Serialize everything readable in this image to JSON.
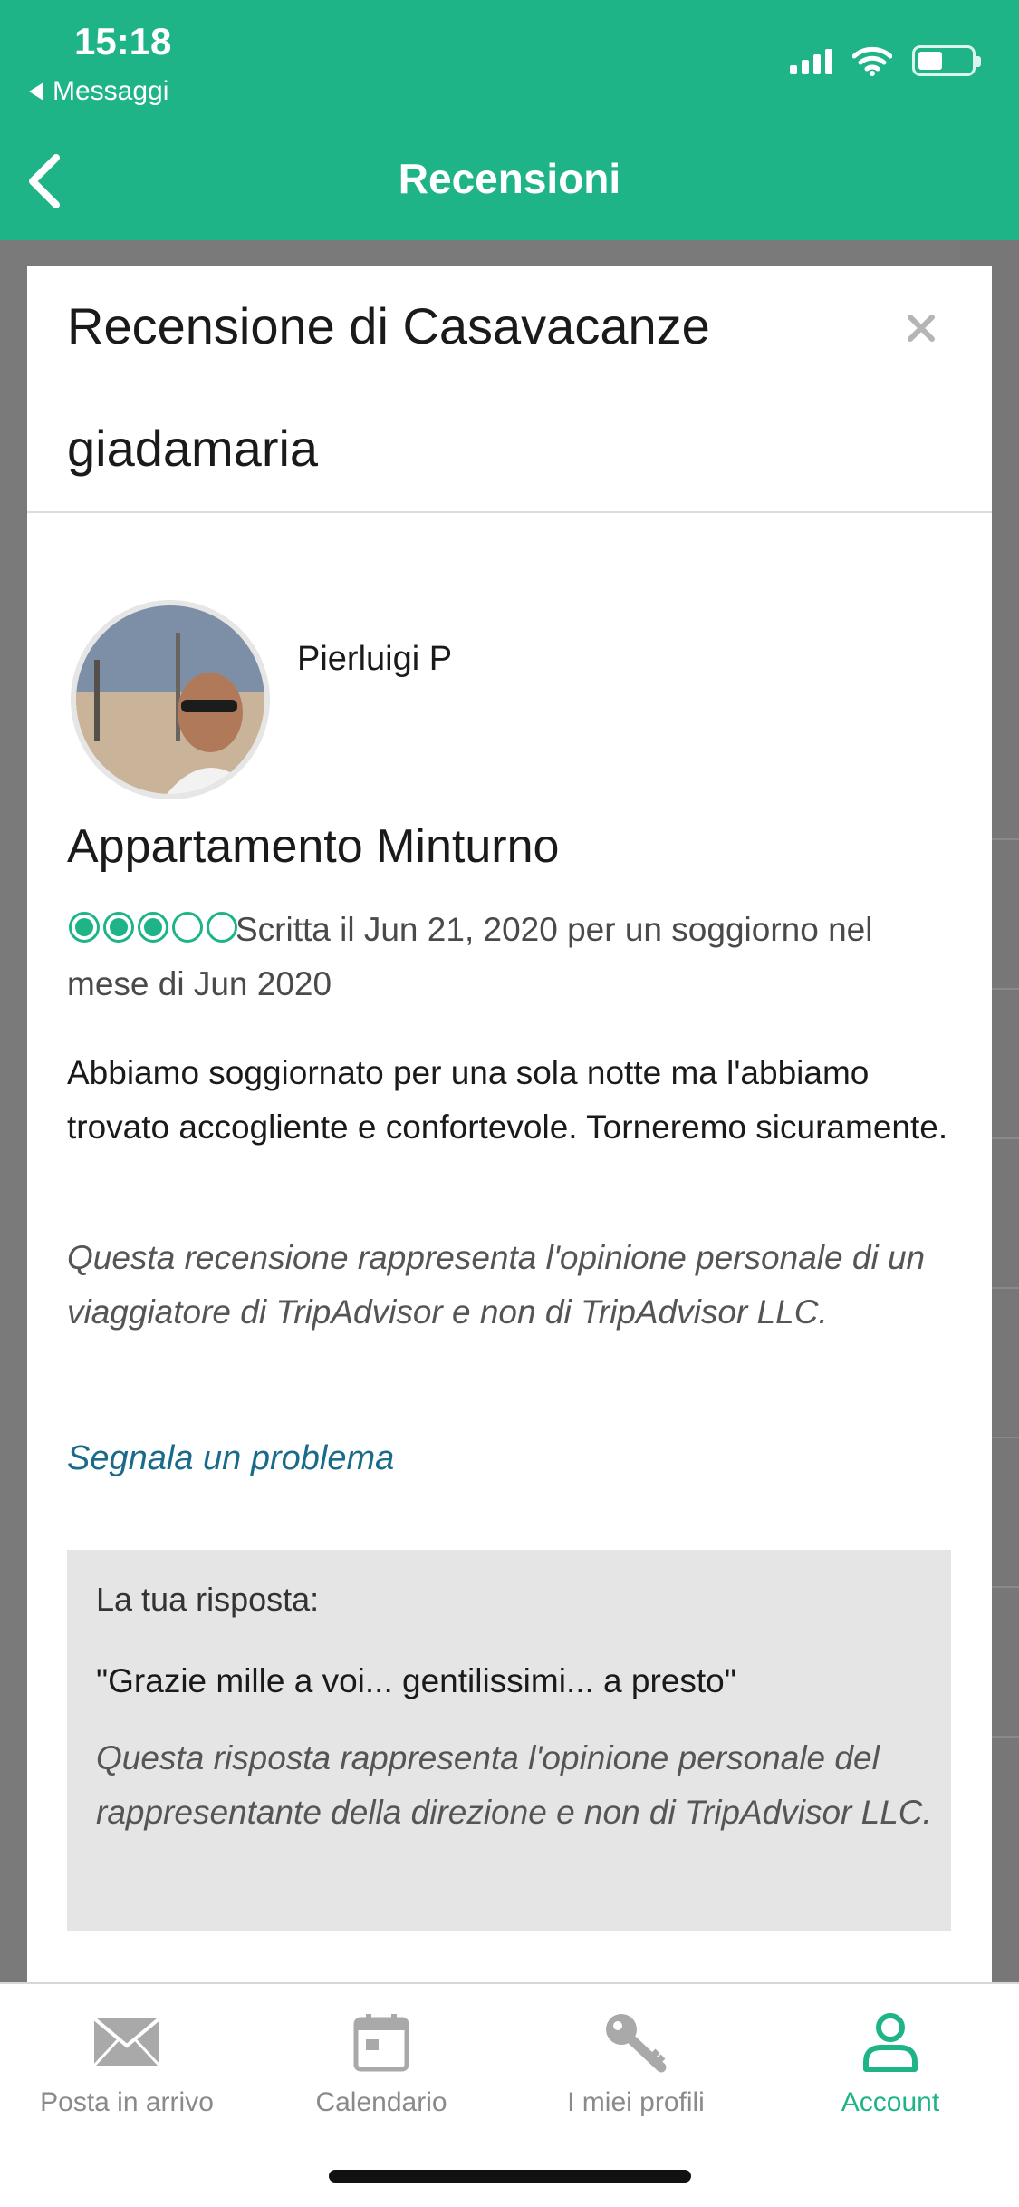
{
  "status_bar": {
    "time": "15:18",
    "back_app": "Messaggi"
  },
  "nav": {
    "title": "Recensioni"
  },
  "modal": {
    "title": "Recensione di Casavacanze giadamaria"
  },
  "review": {
    "author": "Pierluigi P",
    "title": "Appartamento Minturno",
    "rating": 3,
    "rating_max": 5,
    "meta": "Scritta il Jun 21, 2020 per un soggiorno nel mese di Jun 2020",
    "body": "Abbiamo soggiornato per una sola notte ma l'abbiamo trovato accogliente e confortevole. Torneremo sicuramente.",
    "disclaimer": "Questa recensione rappresenta l'opinione personale di un viaggiatore di TripAdvisor e non di TripAdvisor LLC.",
    "report_link": "Segnala un problema"
  },
  "response": {
    "label": "La tua risposta:",
    "text": "\"Grazie mille a voi... gentilissimi... a presto\"",
    "disclaimer": "Questa risposta rappresenta l'opinione personale del rappresentante della direzione e non di TripAdvisor LLC."
  },
  "tabs": [
    {
      "label": "Posta in arrivo",
      "icon": "envelope-icon"
    },
    {
      "label": "Calendario",
      "icon": "calendar-icon"
    },
    {
      "label": "I miei profili",
      "icon": "key-icon"
    },
    {
      "label": "Account",
      "icon": "person-icon",
      "active": true
    }
  ],
  "colors": {
    "brand": "#1fb487",
    "link": "#1a6a8a",
    "response_bg": "#e5e5e5"
  }
}
